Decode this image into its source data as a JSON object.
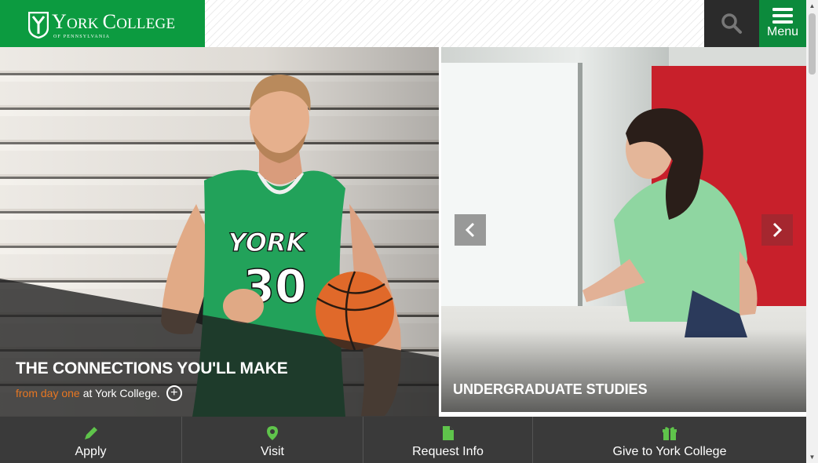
{
  "brand": {
    "name_first_letter": "Y",
    "name_rest_1": "ORK ",
    "name_c": "C",
    "name_rest_2": "OLLEGE",
    "tagline": "OF PENNSYLVANIA",
    "color": "#0c9b40"
  },
  "header": {
    "search_icon": "search-icon",
    "menu_icon": "hamburger-icon",
    "menu_label": "Menu"
  },
  "hero": {
    "primary": {
      "title": "THE CONNECTIONS YOU'LL MAKE",
      "subtitle_accent": "from day one",
      "subtitle_rest": "at York College.",
      "more_icon": "plus-circle-icon",
      "jersey_text": "YORK",
      "jersey_number": "30"
    },
    "secondary": {
      "title": "UNDERGRADUATE STUDIES"
    },
    "prev_icon": "chevron-left-icon",
    "next_icon": "chevron-right-icon"
  },
  "bottom_nav": [
    {
      "label": "Apply",
      "icon": "pencil-icon"
    },
    {
      "label": "Visit",
      "icon": "map-pin-icon"
    },
    {
      "label": "Request Info",
      "icon": "document-icon"
    },
    {
      "label": "Give to York College",
      "icon": "gift-icon"
    }
  ],
  "colors": {
    "green": "#0c9b40",
    "dark_green": "#0c8a3c",
    "accent_orange": "#e87722",
    "icon_green": "#5fc44b",
    "nav_bg": "#3a3a3a"
  }
}
